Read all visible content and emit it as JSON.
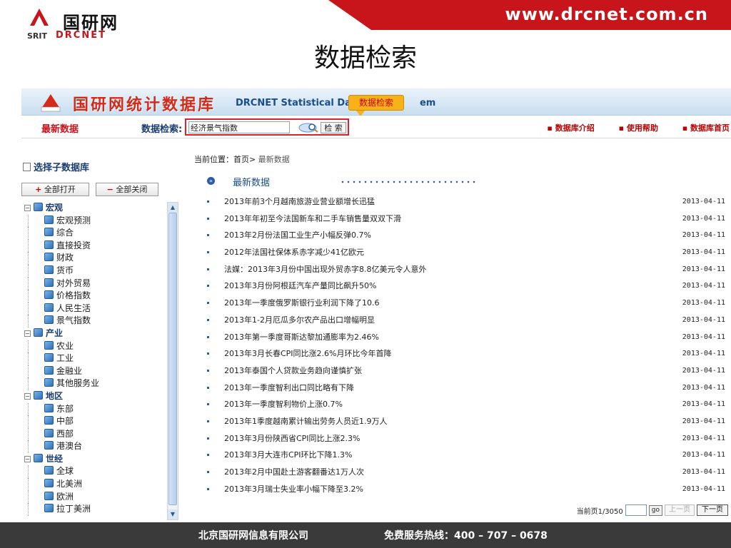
{
  "slide": {
    "url": "www.drcnet.com.cn",
    "logo_cn": "国研网",
    "logo_en_prefix": "SRIT",
    "logo_en": "DRCNET",
    "title": "数据检索"
  },
  "app": {
    "banner_title": "国研网统计数据库",
    "banner_sub": "DRCNET Statistical Da",
    "banner_sub_tail": "em",
    "callout": "数据检索",
    "nav": {
      "newest": "最新数据",
      "search_label": "数据检索:",
      "search_value": "经济景气指数",
      "search_button": "检 索",
      "links": [
        "数据库介绍",
        "使用帮助",
        "数据库首页"
      ]
    },
    "sidebar": {
      "heading": "选择子数据库",
      "open_all": "全部打开",
      "close_all": "全部关闭",
      "tree": [
        {
          "type": "cat",
          "label": "宏观"
        },
        {
          "type": "leaf",
          "label": "宏观预测"
        },
        {
          "type": "leaf",
          "label": "综合"
        },
        {
          "type": "leaf",
          "label": "直接投资"
        },
        {
          "type": "leaf",
          "label": "财政"
        },
        {
          "type": "leaf",
          "label": "货币"
        },
        {
          "type": "leaf",
          "label": "对外贸易"
        },
        {
          "type": "leaf",
          "label": "价格指数"
        },
        {
          "type": "leaf",
          "label": "人民生活"
        },
        {
          "type": "leaf",
          "label": "景气指数"
        },
        {
          "type": "cat",
          "label": "产业"
        },
        {
          "type": "leaf",
          "label": "农业"
        },
        {
          "type": "leaf",
          "label": "工业"
        },
        {
          "type": "leaf",
          "label": "金融业"
        },
        {
          "type": "leaf",
          "label": "其他服务业"
        },
        {
          "type": "cat",
          "label": "地区"
        },
        {
          "type": "leaf",
          "label": "东部"
        },
        {
          "type": "leaf",
          "label": "中部"
        },
        {
          "type": "leaf",
          "label": "西部"
        },
        {
          "type": "leaf",
          "label": "港澳台"
        },
        {
          "type": "cat",
          "label": "世经"
        },
        {
          "type": "leaf",
          "label": "全球"
        },
        {
          "type": "leaf",
          "label": "北美洲"
        },
        {
          "type": "leaf",
          "label": "欧洲"
        },
        {
          "type": "leaf",
          "label": "拉丁美洲"
        }
      ]
    },
    "main": {
      "breadcrumb_label": "当前位置：",
      "breadcrumb_home": "首页",
      "breadcrumb_sep": "> ",
      "breadcrumb_current": "最新数据",
      "section_title": "最新数据",
      "news": [
        {
          "title": "2013年前3个月越南旅游业营业额增长迅猛",
          "date": "2013-04-11"
        },
        {
          "title": "2013年年初至今法国新车和二手车销售量双双下滑",
          "date": "2013-04-11"
        },
        {
          "title": "2013年2月份法国工业生产小幅反弹0.7%",
          "date": "2013-04-11"
        },
        {
          "title": "2012年法国社保体系赤字减少41亿欧元",
          "date": "2013-04-11"
        },
        {
          "title": "法媒：2013年3月份中国出现外贸赤字8.8亿美元令人意外",
          "date": "2013-04-11"
        },
        {
          "title": "2013年3月份阿根廷汽车产量同比飙升50%",
          "date": "2013-04-11"
        },
        {
          "title": "2013年一季度俄罗斯银行业利润下降了10.6",
          "date": "2013-04-11"
        },
        {
          "title": "2013年1-2月厄瓜多尔农产品出口增幅明显",
          "date": "2013-04-11"
        },
        {
          "title": "2013年第一季度哥斯达黎加通膨率为2.46%",
          "date": "2013-04-11"
        },
        {
          "title": "2013年3月长春CPI同比涨2.6%月环比今年首降",
          "date": "2013-04-11"
        },
        {
          "title": "2013年泰国个人贷款业务趋向谨慎扩张",
          "date": "2013-04-11"
        },
        {
          "title": "2013年一季度智利出口同比略有下降",
          "date": "2013-04-11"
        },
        {
          "title": "2013年一季度智利物价上涨0.7%",
          "date": "2013-04-11"
        },
        {
          "title": "2013年1季度越南累计输出劳务人员近1.9万人",
          "date": "2013-04-11"
        },
        {
          "title": "2013年3月份陕西省CPI同比上涨2.3%",
          "date": "2013-04-11"
        },
        {
          "title": "2013年3月大连市CPI环比下降1.3%",
          "date": "2013-04-11"
        },
        {
          "title": "2013年2月中国赴土游客翻番达1万人次",
          "date": "2013-04-11"
        },
        {
          "title": "2013年3月瑞士失业率小幅下降至3.2%",
          "date": "2013-04-11"
        }
      ],
      "pager": {
        "current": "当前页1/3050",
        "go": "go",
        "prev": "上一页",
        "next": "下一页"
      }
    }
  },
  "footer": {
    "company": "北京国研网信息有限公司",
    "hotline": "免费服务热线：400 – 707 – 0678"
  },
  "colors": {
    "brand_red": "#c8141b",
    "nav_blue": "#1a3c6e",
    "footer_bg": "#3a3a3a"
  }
}
